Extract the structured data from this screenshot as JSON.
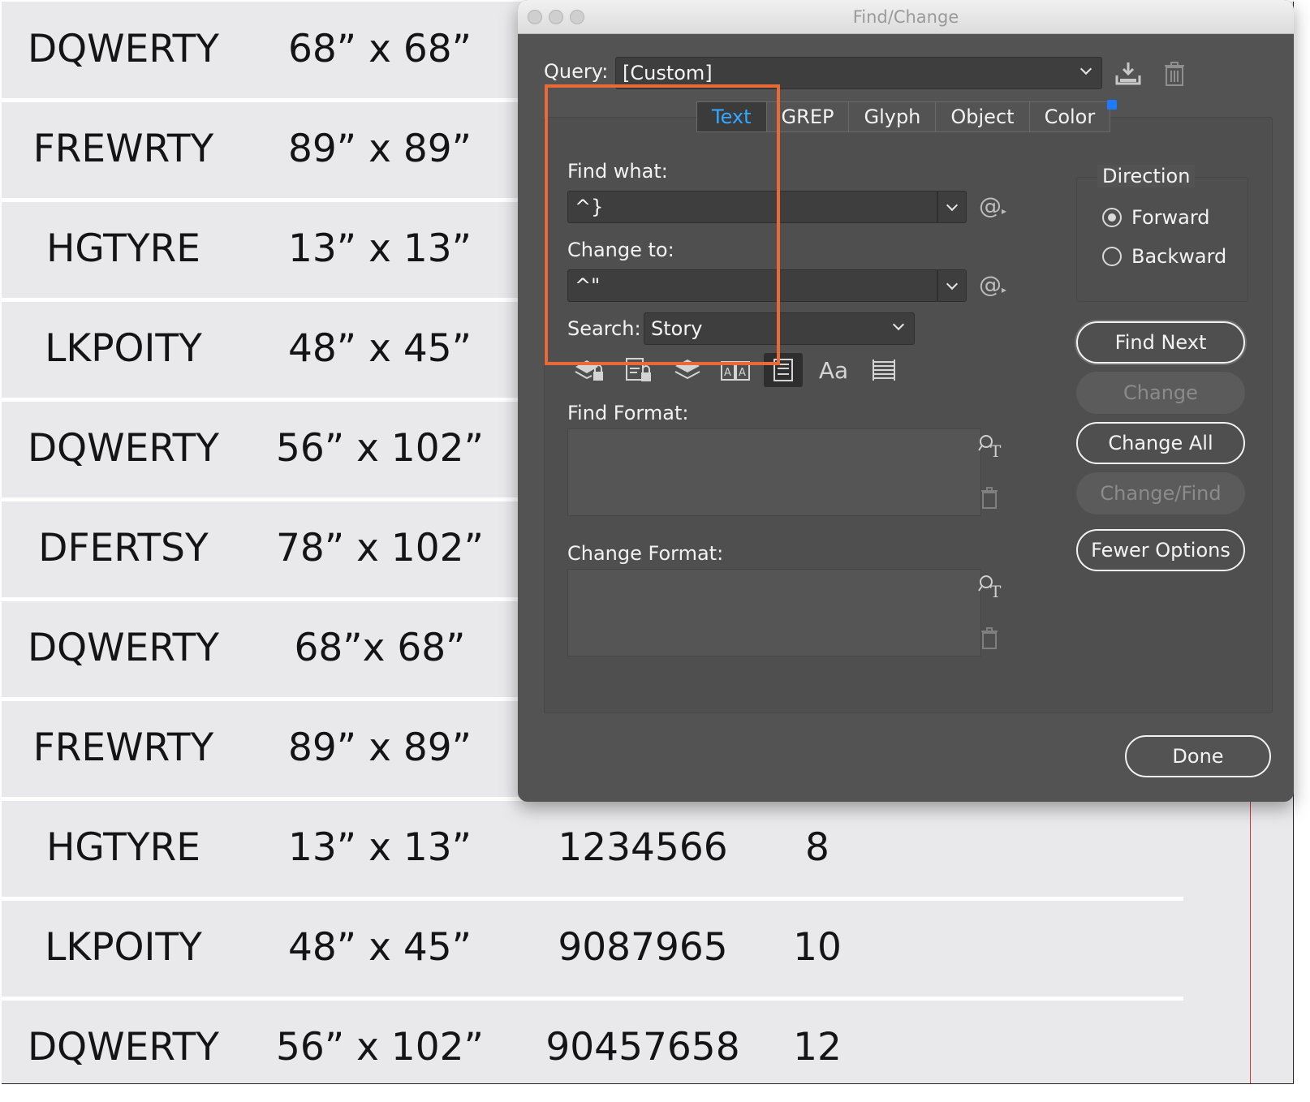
{
  "document": {
    "rows": [
      {
        "code": "DQWERTY",
        "size": "68” x 68”",
        "number": "",
        "qty": ""
      },
      {
        "code": "FREWRTY",
        "size": "89” x 89”",
        "number": "",
        "qty": ""
      },
      {
        "code": "HGTYRE",
        "size": "13” x 13”",
        "number": "",
        "qty": ""
      },
      {
        "code": "LKPOITY",
        "size": "48” x 45”",
        "number": "",
        "qty": ""
      },
      {
        "code": "DQWERTY",
        "size": "56” x 102”",
        "number": "",
        "qty": ""
      },
      {
        "code": "DFERTSY",
        "size": "78” x 102”",
        "number": "",
        "qty": ""
      },
      {
        "code": "DQWERTY",
        "size": "68”x 68”",
        "number": "",
        "qty": ""
      },
      {
        "code": "FREWRTY",
        "size": "89” x 89”",
        "number": "",
        "qty": ""
      },
      {
        "code": "HGTYRE",
        "size": "13” x 13”",
        "number": "1234566",
        "qty": "8"
      },
      {
        "code": "LKPOITY",
        "size": "48” x 45”",
        "number": "9087965",
        "qty": "10"
      },
      {
        "code": "DQWERTY",
        "size": "56” x 102”",
        "number": "90457658",
        "qty": "12"
      }
    ]
  },
  "dialog": {
    "title": "Find/Change",
    "query": {
      "label": "Query:",
      "value": "[Custom]"
    },
    "tabs": [
      "Text",
      "GREP",
      "Glyph",
      "Object",
      "Color"
    ],
    "active_tab": "Text",
    "find_what": {
      "label": "Find what:",
      "value": "^}"
    },
    "change_to": {
      "label": "Change to:",
      "value": "^\""
    },
    "search": {
      "label": "Search:",
      "value": "Story"
    },
    "options_icons": [
      "locked-layers-icon",
      "locked-stories-icon",
      "hidden-layers-icon",
      "master-pages-icon",
      "footnotes-icon",
      "case-sensitive-icon",
      "whole-word-icon"
    ],
    "case_sensitive_glyph": "Aa",
    "find_format_label": "Find Format:",
    "change_format_label": "Change Format:",
    "direction": {
      "label": "Direction",
      "forward": "Forward",
      "backward": "Backward",
      "selected": "Forward"
    },
    "buttons": {
      "find_next": "Find Next",
      "change": "Change",
      "change_all": "Change All",
      "change_find": "Change/Find",
      "fewer_options": "Fewer Options",
      "done": "Done"
    },
    "special_char_glyph": "@",
    "colors": {
      "accent_tab": "#35a8ff",
      "highlight": "#e96a37",
      "dot": "#1e7bff"
    }
  }
}
